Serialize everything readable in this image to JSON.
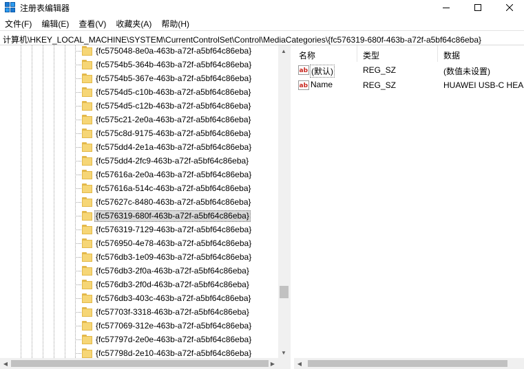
{
  "window": {
    "title": "注册表编辑器",
    "icon": "regedit-icon"
  },
  "menu": [
    {
      "label": "文件(F)"
    },
    {
      "label": "编辑(E)"
    },
    {
      "label": "查看(V)"
    },
    {
      "label": "收藏夹(A)"
    },
    {
      "label": "帮助(H)"
    }
  ],
  "address": {
    "path": "计算机\\HKEY_LOCAL_MACHINE\\SYSTEM\\CurrentControlSet\\Control\\MediaCategories\\{fc576319-680f-463b-a72f-a5bf64c86eba}"
  },
  "tree": {
    "items": [
      {
        "label": "{fc575048-8e0a-463b-a72f-a5bf64c86eba}",
        "selected": false
      },
      {
        "label": "{fc5754b5-364b-463b-a72f-a5bf64c86eba}",
        "selected": false
      },
      {
        "label": "{fc5754b5-367e-463b-a72f-a5bf64c86eba}",
        "selected": false
      },
      {
        "label": "{fc5754d5-c10b-463b-a72f-a5bf64c86eba}",
        "selected": false
      },
      {
        "label": "{fc5754d5-c12b-463b-a72f-a5bf64c86eba}",
        "selected": false
      },
      {
        "label": "{fc575c21-2e0a-463b-a72f-a5bf64c86eba}",
        "selected": false
      },
      {
        "label": "{fc575c8d-9175-463b-a72f-a5bf64c86eba}",
        "selected": false
      },
      {
        "label": "{fc575dd4-2e1a-463b-a72f-a5bf64c86eba}",
        "selected": false
      },
      {
        "label": "{fc575dd4-2fc9-463b-a72f-a5bf64c86eba}",
        "selected": false
      },
      {
        "label": "{fc57616a-2e0a-463b-a72f-a5bf64c86eba}",
        "selected": false
      },
      {
        "label": "{fc57616a-514c-463b-a72f-a5bf64c86eba}",
        "selected": false
      },
      {
        "label": "{fc57627c-8480-463b-a72f-a5bf64c86eba}",
        "selected": false
      },
      {
        "label": "{fc576319-680f-463b-a72f-a5bf64c86eba}",
        "selected": true
      },
      {
        "label": "{fc576319-7129-463b-a72f-a5bf64c86eba}",
        "selected": false
      },
      {
        "label": "{fc576950-4e78-463b-a72f-a5bf64c86eba}",
        "selected": false
      },
      {
        "label": "{fc576db3-1e09-463b-a72f-a5bf64c86eba}",
        "selected": false
      },
      {
        "label": "{fc576db3-2f0a-463b-a72f-a5bf64c86eba}",
        "selected": false
      },
      {
        "label": "{fc576db3-2f0d-463b-a72f-a5bf64c86eba}",
        "selected": false
      },
      {
        "label": "{fc576db3-403c-463b-a72f-a5bf64c86eba}",
        "selected": false
      },
      {
        "label": "{fc57703f-3318-463b-a72f-a5bf64c86eba}",
        "selected": false
      },
      {
        "label": "{fc577069-312e-463b-a72f-a5bf64c86eba}",
        "selected": false
      },
      {
        "label": "{fc57797d-2e0e-463b-a72f-a5bf64c86eba}",
        "selected": false
      },
      {
        "label": "{fc57798d-2e10-463b-a72f-a5bf64c86eba}",
        "selected": false
      }
    ]
  },
  "values": {
    "columns": {
      "name": "名称",
      "type": "类型",
      "data": "数据"
    },
    "rows": [
      {
        "icon": "string-value-icon",
        "name": "(默认)",
        "type": "REG_SZ",
        "data": "(数值未设置)",
        "focused": true
      },
      {
        "icon": "string-value-icon",
        "name": "Name",
        "type": "REG_SZ",
        "data": "HUAWEI USB-C HEADSET",
        "focused": false
      }
    ]
  }
}
